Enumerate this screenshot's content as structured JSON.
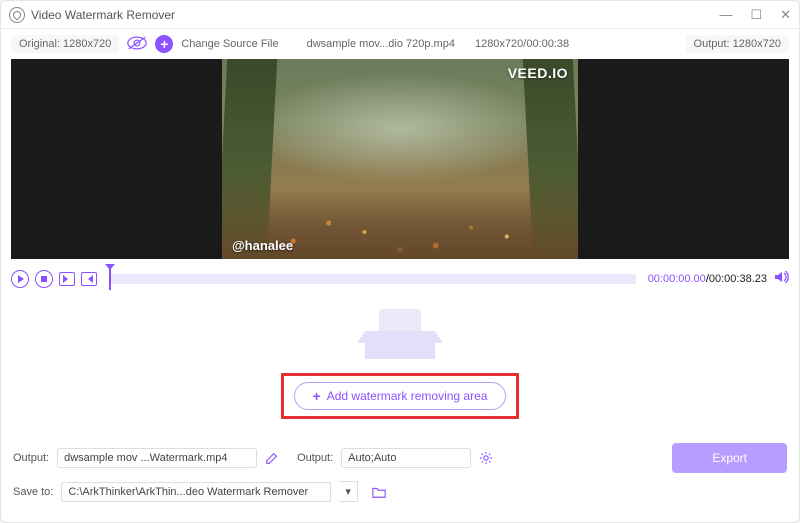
{
  "titlebar": {
    "title": "Video Watermark Remover"
  },
  "toolbar": {
    "original_label": "Original: 1280x720",
    "change_source": "Change Source File",
    "filename": "dwsample mov...dio 720p.mp4",
    "resolution_time": "1280x720/00:00:38",
    "output_label": "Output: 1280x720"
  },
  "preview": {
    "watermark_top": "VEED.IO",
    "watermark_bottom": "@hanalee"
  },
  "player": {
    "current": "00:00:00.00",
    "duration": "00:00:38.23"
  },
  "drop": {
    "add_button": "Add watermark removing area"
  },
  "bottom": {
    "output_label": "Output:",
    "output_file": "dwsample mov ...Watermark.mp4",
    "output2_label": "Output:",
    "output2_value": "Auto;Auto",
    "save_label": "Save to:",
    "save_path": "C:\\ArkThinker\\ArkThin...deo Watermark Remover",
    "export": "Export"
  }
}
